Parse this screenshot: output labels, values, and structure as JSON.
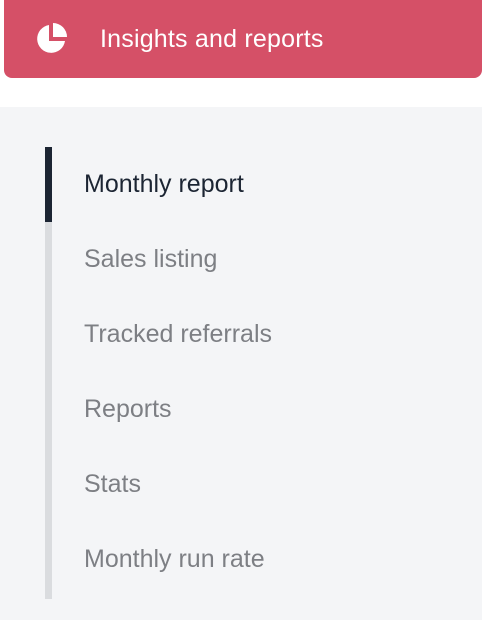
{
  "header": {
    "title": "Insights and reports",
    "icon": "pie-chart-icon",
    "background_color": "#d55067"
  },
  "nav": {
    "items": [
      {
        "label": "Monthly report",
        "active": true
      },
      {
        "label": "Sales listing",
        "active": false
      },
      {
        "label": "Tracked referrals",
        "active": false
      },
      {
        "label": "Reports",
        "active": false
      },
      {
        "label": "Stats",
        "active": false
      },
      {
        "label": "Monthly run rate",
        "active": false
      }
    ],
    "active_color": "#1c2533",
    "inactive_color": "#7d7f84"
  }
}
